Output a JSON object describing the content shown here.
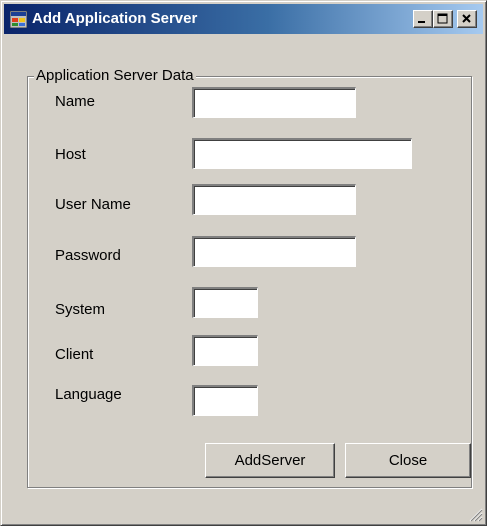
{
  "window": {
    "title": "Add Application Server",
    "icon": "app-window-icon",
    "controls": [
      "minimize-icon",
      "maximize-icon",
      "close-icon"
    ]
  },
  "group": {
    "caption": "Application Server Data"
  },
  "fields": {
    "name": {
      "label": "Name",
      "value": ""
    },
    "host": {
      "label": "Host",
      "value": ""
    },
    "user_name": {
      "label": "User Name",
      "value": ""
    },
    "password": {
      "label": "Password",
      "value": ""
    },
    "system": {
      "label": "System",
      "value": ""
    },
    "client": {
      "label": "Client",
      "value": ""
    },
    "language": {
      "label": "Language",
      "value": ""
    }
  },
  "buttons": {
    "add_server": "AddServer",
    "close": "Close"
  },
  "colors": {
    "window_face": "#d4d0c8",
    "titlebar_start": "#0a246a",
    "titlebar_end": "#a6caf0",
    "title_text": "#ffffff"
  }
}
